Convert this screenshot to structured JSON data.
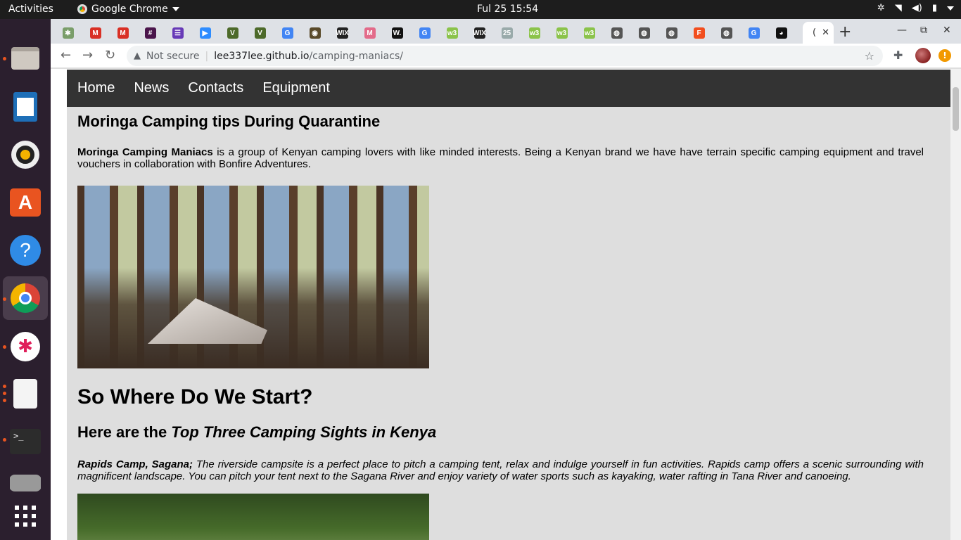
{
  "topbar": {
    "activities": "Activities",
    "app_name": "Google Chrome",
    "clock": "Ful 25  15:54"
  },
  "dock": {
    "items": [
      "files-icon",
      "writer-icon",
      "rhythmbox-icon",
      "software-center-icon",
      "help-icon",
      "chrome-icon",
      "slack-icon",
      "document-icon",
      "terminal-icon",
      "drive-icon",
      "show-apps-icon"
    ]
  },
  "tabs": {
    "favicons": [
      {
        "name": "palm-icon",
        "glyph": "✱",
        "color": "#7a9e6a"
      },
      {
        "name": "gmail-icon",
        "glyph": "M",
        "color": "#d93025"
      },
      {
        "name": "gmail-icon-2",
        "glyph": "M",
        "color": "#d93025"
      },
      {
        "name": "slack-favicon",
        "glyph": "#",
        "color": "#4a154b"
      },
      {
        "name": "forms-icon",
        "glyph": "☰",
        "color": "#673ab7"
      },
      {
        "name": "zoom-icon",
        "glyph": "▶",
        "color": "#2d8cff"
      },
      {
        "name": "wix-v-icon",
        "glyph": "V",
        "color": "#4d6a2a"
      },
      {
        "name": "wix-v-icon-2",
        "glyph": "V",
        "color": "#4d6a2a"
      },
      {
        "name": "google-icon",
        "glyph": "G",
        "color": "#4285f4"
      },
      {
        "name": "pic-icon",
        "glyph": "◉",
        "color": "#5a4a2a"
      },
      {
        "name": "wix-icon",
        "glyph": "WIX",
        "color": "#222"
      },
      {
        "name": "mail-icon",
        "glyph": "M",
        "color": "#e36b8a"
      },
      {
        "name": "w-icon",
        "glyph": "W.",
        "color": "#111"
      },
      {
        "name": "google-icon-2",
        "glyph": "G",
        "color": "#4285f4"
      },
      {
        "name": "w3-icon",
        "glyph": "w3",
        "color": "#8bc34a"
      },
      {
        "name": "wix-icon-2",
        "glyph": "WIX",
        "color": "#222"
      },
      {
        "name": "calendar-icon",
        "glyph": "25",
        "color": "#9aa"
      },
      {
        "name": "w3-icon-2",
        "glyph": "w3",
        "color": "#8bc34a"
      },
      {
        "name": "w3-icon-3",
        "glyph": "w3",
        "color": "#8bc34a"
      },
      {
        "name": "w3-icon-4",
        "glyph": "w3",
        "color": "#8bc34a"
      },
      {
        "name": "globe-icon",
        "glyph": "◍",
        "color": "#555"
      },
      {
        "name": "globe-icon-2",
        "glyph": "◍",
        "color": "#555"
      },
      {
        "name": "globe-icon-3",
        "glyph": "◍",
        "color": "#555"
      },
      {
        "name": "figma-icon",
        "glyph": "F",
        "color": "#f24e1e"
      },
      {
        "name": "globe-icon-4",
        "glyph": "◍",
        "color": "#555"
      },
      {
        "name": "google-icon-3",
        "glyph": "G",
        "color": "#4285f4"
      },
      {
        "name": "github-icon",
        "glyph": "◕",
        "color": "#111"
      }
    ],
    "active_label": "("
  },
  "toolbar": {
    "security": "Not secure",
    "url_host": "lee337lee.github.io",
    "url_path": "/camping-maniacs/"
  },
  "page": {
    "nav": [
      "Home",
      "News",
      "Contacts",
      "Equipment"
    ],
    "title": "Moringa Camping tips During Quarantine",
    "intro_bold": "Moringa Camping Maniacs",
    "intro_rest": " is a group of Kenyan camping lovers with like minded interests. Being a Kenyan brand we have have terrain specific camping equipment and travel vouchers in collaboration with Bonfire Adventures.",
    "start_heading": "So Where Do We Start?",
    "top_prefix": "Here are the ",
    "top_emph": "Top Three Camping Sights in Kenya",
    "rapids_bold": "Rapids Camp, Sagana;",
    "rapids_rest": " The riverside campsite is a perfect place to pitch a camping tent, relax and indulge yourself in fun activities. Rapids camp offers a scenic surrounding with magnificent landscape. You can pitch your tent next to the Sagana River and enjoy variety of water sports such as kayaking, water rafting in Tana River and canoeing."
  }
}
